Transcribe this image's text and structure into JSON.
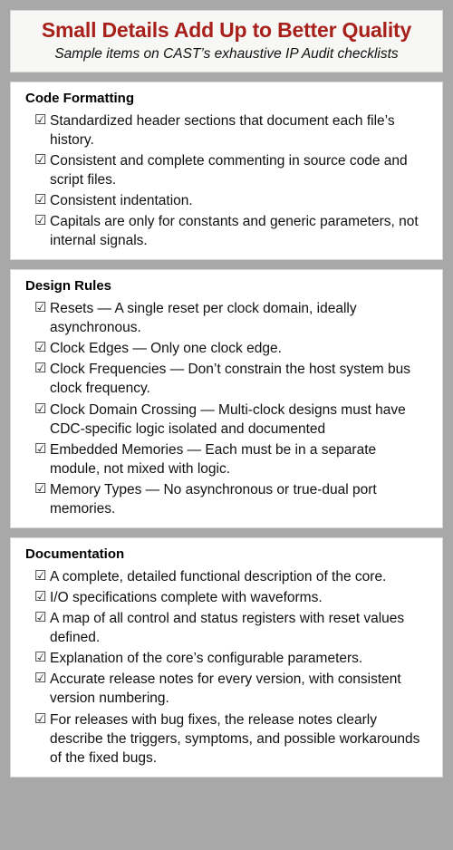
{
  "header": {
    "title": "Small Details Add Up to Better Quality",
    "subtitle": "Sample items on CAST’s exhaustive IP Audit checklists",
    "title_color": "#a8201a",
    "subtitle_color": "#111111"
  },
  "theme": {
    "frame_color": "#a8a8a8",
    "card_background": "#ffffff",
    "header_card_background": "#f7f7f5",
    "card_border_color": "#d7d7d7",
    "text_color": "#111111"
  },
  "checkbox_glyph": "☑",
  "sections": [
    {
      "heading": "Code Formatting",
      "items": [
        "Standardized header sections that document each file’s history.",
        "Consistent and complete commenting in source code and script files.",
        "Consistent indentation.",
        "Capitals are only for constants and generic parameters, not internal signals."
      ]
    },
    {
      "heading": "Design Rules",
      "items": [
        "Resets — A single reset per clock domain, ideally asynchronous.",
        "Clock Edges — Only one clock edge.",
        "Clock Frequencies — Don’t constrain the host system bus clock frequency.",
        "Clock Domain Crossing — Multi-clock designs must have CDC-specific logic isolated and documented",
        "Embedded Memories — Each must be in a separate module, not mixed with logic.",
        "Memory Types — No asynchronous or true-dual port memories."
      ]
    },
    {
      "heading": "Documentation",
      "items": [
        "A complete, detailed functional description of the core.",
        "I/O specifications complete with waveforms.",
        "A map of all control and status registers with reset values defined.",
        "Explanation of the core’s configurable parameters.",
        "Accurate release notes for every version, with consistent version numbering.",
        "For releases with bug fixes, the release notes clearly describe the triggers, symptoms, and possible workarounds of the fixed bugs."
      ]
    }
  ]
}
